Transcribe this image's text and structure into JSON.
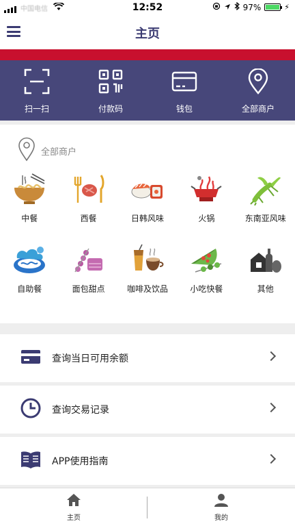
{
  "status": {
    "carrier": "中国电信",
    "time": "12:52",
    "battery": "97%",
    "battery_level": 0.97
  },
  "header": {
    "title": "主页"
  },
  "quick_actions": [
    {
      "label": "扫一扫",
      "icon": "scan-icon"
    },
    {
      "label": "付款码",
      "icon": "qr-code-icon"
    },
    {
      "label": "钱包",
      "icon": "wallet-card-icon"
    },
    {
      "label": "全部商户",
      "icon": "location-pin-icon"
    }
  ],
  "merchants": {
    "heading": "全部商户",
    "categories": [
      {
        "label": "中餐",
        "icon": "noodle-bowl-icon"
      },
      {
        "label": "西餐",
        "icon": "fork-steak-knife-icon"
      },
      {
        "label": "日韩风味",
        "icon": "sushi-icon"
      },
      {
        "label": "火锅",
        "icon": "hotpot-icon"
      },
      {
        "label": "东南亚风味",
        "icon": "lobster-icon"
      },
      {
        "label": "自助餐",
        "icon": "buffet-plate-icon"
      },
      {
        "label": "面包甜点",
        "icon": "dessert-icon"
      },
      {
        "label": "咖啡及饮品",
        "icon": "coffee-drink-icon"
      },
      {
        "label": "小吃快餐",
        "icon": "pizza-skewer-icon"
      },
      {
        "label": "其他",
        "icon": "other-food-icon"
      }
    ]
  },
  "menu": [
    {
      "label": "查询当日可用余额",
      "icon": "card-icon"
    },
    {
      "label": "查询交易记录",
      "icon": "clock-icon"
    },
    {
      "label": "APP使用指南",
      "icon": "book-icon"
    }
  ],
  "tabs": [
    {
      "label": "主页",
      "icon": "home-icon"
    },
    {
      "label": "我的",
      "icon": "user-icon"
    }
  ],
  "colors": {
    "brand": "#47477a",
    "accent_red": "#c8102e"
  }
}
